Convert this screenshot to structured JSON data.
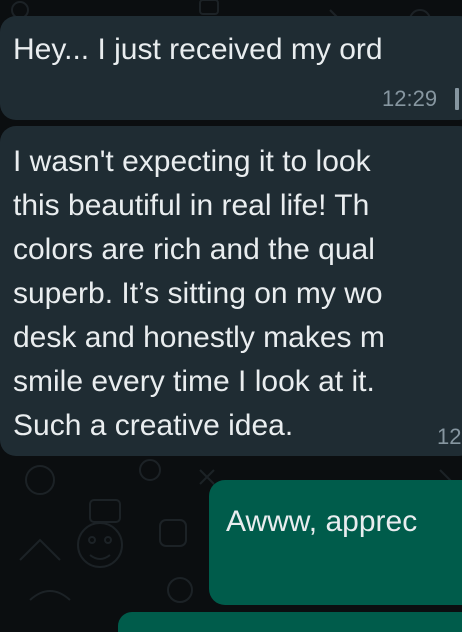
{
  "messages": [
    {
      "direction": "incoming",
      "text": "Hey... I just received my ord",
      "time": "12:29"
    },
    {
      "direction": "incoming",
      "text": "I wasn't expecting it to look\nthis beautiful in real life! Th\ncolors are rich and the qual\nsuperb. It’s sitting on my wo\ndesk and honestly makes m\nsmile every time I look at it.\nSuch a creative idea.",
      "time": "12"
    },
    {
      "direction": "outgoing",
      "text": "Awww, apprec"
    }
  ],
  "colors": {
    "incoming_bubble": "#1f2c33",
    "outgoing_bubble": "#005c4b",
    "text": "#e9edef",
    "timestamp": "#8696a0",
    "background": "#0b0e10"
  }
}
